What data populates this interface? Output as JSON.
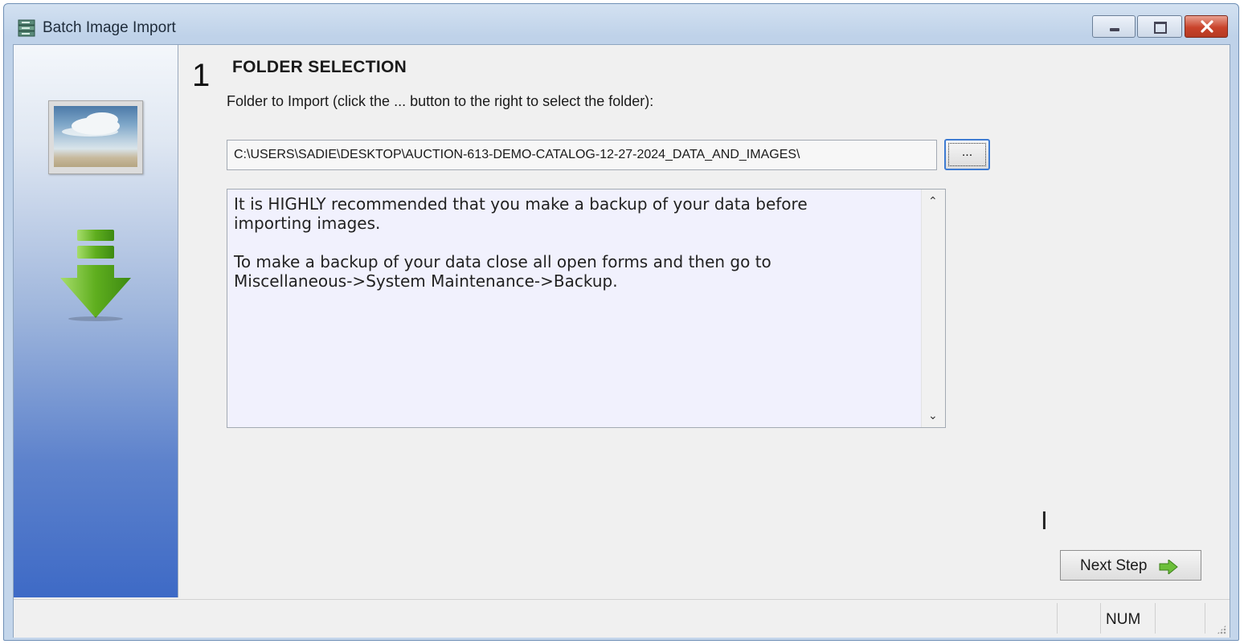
{
  "window": {
    "title": "Batch Image Import",
    "controls": {
      "minimize_icon": "minimize-icon",
      "maximize_icon": "maximize-icon",
      "close_icon": "close-icon"
    }
  },
  "sidebar": {
    "image_icon": "landscape-image-icon",
    "download_icon": "download-arrow-icon"
  },
  "step": {
    "number": "1",
    "title": "FOLDER SELECTION"
  },
  "folder": {
    "label": "Folder to Import (click the ... button to the right to select the folder):",
    "path_value": "C:\\USERS\\SADIE\\DESKTOP\\AUCTION-613-DEMO-CATALOG-12-27-2024_DATA_AND_IMAGES\\",
    "browse_label": "..."
  },
  "notice": {
    "text": "It is HIGHLY recommended that you make a backup of your data before\nimporting images.\n\nTo make a backup of your data close all open forms and then go to\nMiscellaneous->System Maintenance->Backup."
  },
  "buttons": {
    "next_step": "Next Step"
  },
  "statusbar": {
    "num": "NUM"
  },
  "colors": {
    "accent_focus": "#3d7bd2",
    "close_red": "#c9432b",
    "sidebar_blue": "#3e6ac6",
    "arrow_green": "#5fae1e"
  }
}
